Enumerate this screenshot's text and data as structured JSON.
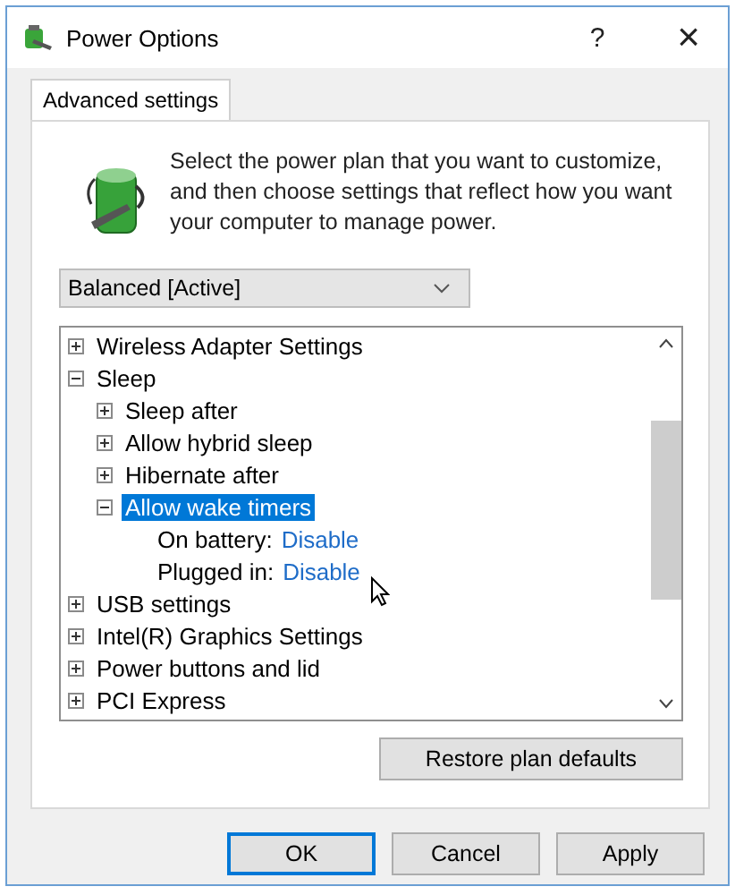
{
  "window": {
    "title": "Power Options",
    "help": "?",
    "close": "×"
  },
  "tabs": [
    {
      "label": "Advanced settings",
      "selected": true
    }
  ],
  "intro": "Select the power plan that you want to customize, and then choose settings that reflect how you want your computer to manage power.",
  "plan_dropdown": {
    "value": "Balanced [Active]"
  },
  "tree": {
    "items": [
      {
        "kind": "node",
        "label": "Wireless Adapter Settings",
        "expanded": false,
        "selected": false
      },
      {
        "kind": "node",
        "label": "Sleep",
        "expanded": true,
        "selected": false,
        "children": [
          {
            "kind": "node",
            "label": "Sleep after",
            "expanded": false,
            "selected": false
          },
          {
            "kind": "node",
            "label": "Allow hybrid sleep",
            "expanded": false,
            "selected": false
          },
          {
            "kind": "node",
            "label": "Hibernate after",
            "expanded": false,
            "selected": false
          },
          {
            "kind": "node",
            "label": "Allow wake timers",
            "expanded": true,
            "selected": true,
            "children": [
              {
                "kind": "setting",
                "label": "On battery:",
                "value": "Disable"
              },
              {
                "kind": "setting",
                "label": "Plugged in:",
                "value": "Disable"
              }
            ]
          }
        ]
      },
      {
        "kind": "node",
        "label": "USB settings",
        "expanded": false,
        "selected": false
      },
      {
        "kind": "node",
        "label": "Intel(R) Graphics Settings",
        "expanded": false,
        "selected": false
      },
      {
        "kind": "node",
        "label": "Power buttons and lid",
        "expanded": false,
        "selected": false
      },
      {
        "kind": "node",
        "label": "PCI Express",
        "expanded": false,
        "selected": false
      }
    ]
  },
  "restore_button": "Restore plan defaults",
  "buttons": [
    {
      "label": "OK",
      "default": true
    },
    {
      "label": "Cancel",
      "default": false
    },
    {
      "label": "Apply",
      "default": false
    }
  ]
}
